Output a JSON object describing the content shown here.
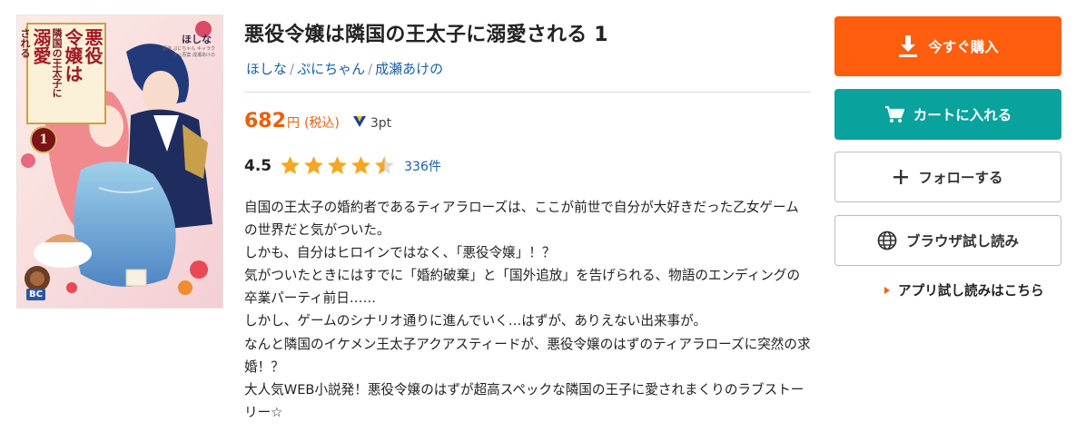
{
  "cover": {
    "title_columns": [
      "悪役",
      "令嬢は",
      "隣国の王太子に",
      "溺愛",
      "される"
    ],
    "volume": "1",
    "author": "ほしな",
    "credits": "原作 ぷにちゃん キャラクター原案 成瀬あけの",
    "publisher": "BC"
  },
  "book": {
    "title": "悪役令嬢は隣国の王太子に溺愛される 1",
    "authors": [
      "ほしな",
      "ぷにちゃん",
      "成瀬あけの"
    ],
    "price": "682",
    "yen": "円",
    "tax": "(税込)",
    "points": "3pt",
    "rating": "4.5",
    "rating_value": 4.5,
    "review_count": "336件",
    "description": [
      "自国の王太子の婚約者であるティアラローズは、ここが前世で自分が大好きだった乙女ゲームの世界だと気がついた。",
      "しかも、自分はヒロインではなく、「悪役令嬢」！？",
      "気がついたときにはすでに「婚約破棄」と「国外追放」を告げられる、物語のエンディングの卒業パーティ前日……",
      "しかし、ゲームのシナリオ通りに進んでいく…はずが、ありえない出来事が。",
      "なんと隣国のイケメン王太子アクアスティードが、悪役令嬢のはずのティアラローズに突然の求婚！？",
      "大人気WEB小説発！悪役令嬢のはずが超高スペックな隣国の王子に愛されまくりのラブストーリー☆"
    ]
  },
  "actions": {
    "buy_label": "今すぐ購入",
    "cart_label": "カートに入れる",
    "follow_label": "フォローする",
    "trial_label": "ブラウザ試し読み",
    "app_trial_label": "アプリ試し読みはこちら"
  },
  "colors": {
    "buy": "#ff5e0e",
    "cart": "#0aa29d",
    "link": "#1a5fa8",
    "price": "#e8600a",
    "star": "#f5a623"
  },
  "icons": {
    "buy": "download-icon",
    "cart": "cart-icon",
    "follow": "plus-icon",
    "trial": "globe-icon",
    "points": "v-point-icon",
    "app_trial": "triangle-right-icon"
  }
}
